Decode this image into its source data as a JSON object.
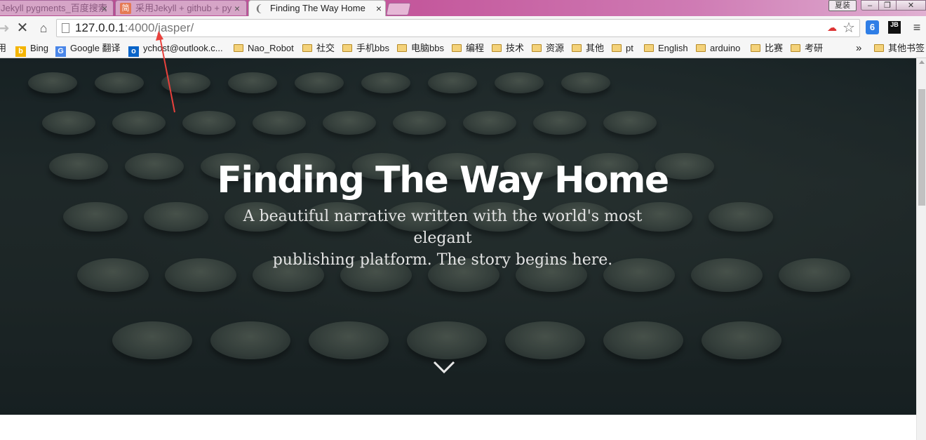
{
  "tabs": [
    {
      "title": "Jekyll pygments_百度搜索",
      "close": "×"
    },
    {
      "favicon": "简",
      "title": "采用Jekyll + github + py",
      "close": "×"
    },
    {
      "title": "Finding The Way Home",
      "close": "×"
    }
  ],
  "ime_badge": "夏装",
  "window_controls": {
    "minimize": "–",
    "restore": "❐",
    "close": "✕"
  },
  "toolbar": {
    "forward": "➜",
    "stop": "✕",
    "home": "⌂",
    "star": "☆",
    "menu": "≡"
  },
  "address": {
    "host": "127.0.0.1",
    "port_path": ":4000/jasper/"
  },
  "extensions": [
    "6",
    "JB"
  ],
  "bookmarks": [
    {
      "label": "用",
      "icon": "none"
    },
    {
      "label": "Bing",
      "icon": "bing-icon"
    },
    {
      "label": "Google 翻译",
      "icon": "google-translate-icon"
    },
    {
      "label": "ychost@outlook.c...",
      "icon": "outlook-icon"
    },
    {
      "label": "Nao_Robot",
      "icon": "folder-icon"
    },
    {
      "label": "社交",
      "icon": "folder-icon"
    },
    {
      "label": "手机bbs",
      "icon": "folder-icon"
    },
    {
      "label": "电脑bbs",
      "icon": "folder-icon"
    },
    {
      "label": "编程",
      "icon": "folder-icon"
    },
    {
      "label": "技术",
      "icon": "folder-icon"
    },
    {
      "label": "资源",
      "icon": "folder-icon"
    },
    {
      "label": "其他",
      "icon": "folder-icon"
    },
    {
      "label": "pt",
      "icon": "folder-icon"
    },
    {
      "label": "English",
      "icon": "folder-icon"
    },
    {
      "label": "arduino",
      "icon": "folder-icon"
    },
    {
      "label": "比赛",
      "icon": "folder-icon"
    },
    {
      "label": "考研",
      "icon": "folder-icon"
    }
  ],
  "bookmarks_overflow": "»",
  "other_bookmarks": "其他书签",
  "hero": {
    "title": "Finding The Way Home",
    "subtitle_line1": "A beautiful narrative written with the world's most elegant",
    "subtitle_line2": "publishing platform. The story begins here."
  },
  "colors": {
    "annotation_arrow": "#e8413c",
    "hero_overlay": "#1c2a2d"
  }
}
